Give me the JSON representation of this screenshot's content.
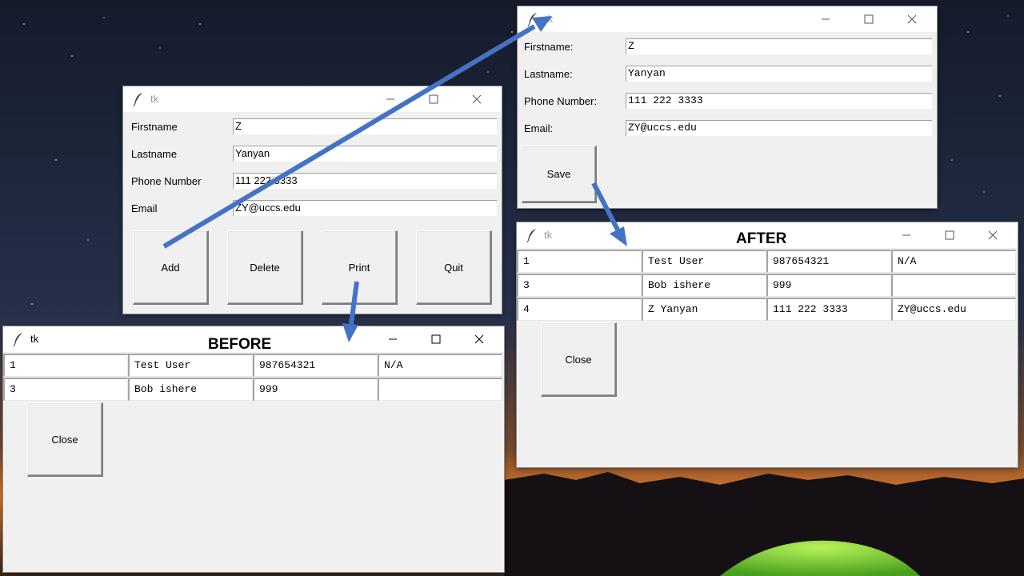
{
  "form_window": {
    "title": "tk",
    "fields": [
      {
        "label": "Firstname",
        "value": "Z"
      },
      {
        "label": "Lastname",
        "value": "Yanyan"
      },
      {
        "label": "Phone Number",
        "value": "111 222 3333"
      },
      {
        "label": "Email",
        "value": "ZY@uccs.edu"
      }
    ],
    "buttons": {
      "add": "Add",
      "delete": "Delete",
      "print": "Print",
      "quit": "Quit"
    }
  },
  "add_window": {
    "title": "tk",
    "fields": [
      {
        "label": "Firstname:",
        "value": "Z"
      },
      {
        "label": "Lastname:",
        "value": "Yanyan"
      },
      {
        "label": "Phone Number:",
        "value": "111 222 3333"
      },
      {
        "label": "Email:",
        "value": "ZY@uccs.edu"
      }
    ],
    "save_label": "Save"
  },
  "before_window": {
    "title": "tk",
    "heading": "BEFORE",
    "rows": [
      [
        "1",
        "Test User",
        "987654321",
        "N/A"
      ],
      [
        "3",
        "Bob ishere",
        "999",
        ""
      ]
    ],
    "close_label": "Close"
  },
  "after_window": {
    "title": "tk",
    "heading": "AFTER",
    "rows": [
      [
        "1",
        "Test User",
        "987654321",
        "N/A"
      ],
      [
        "3",
        "Bob ishere",
        "999",
        ""
      ],
      [
        "4",
        "Z Yanyan",
        "111 222 3333",
        "ZY@uccs.edu"
      ]
    ],
    "close_label": "Close"
  },
  "colors": {
    "arrow": "#4472c4",
    "window_bg": "#f0f0f0",
    "titlebar": "#ffffff"
  },
  "icons": [
    "feather-icon",
    "minimize-icon",
    "maximize-icon",
    "close-icon",
    "arrow-icon"
  ]
}
